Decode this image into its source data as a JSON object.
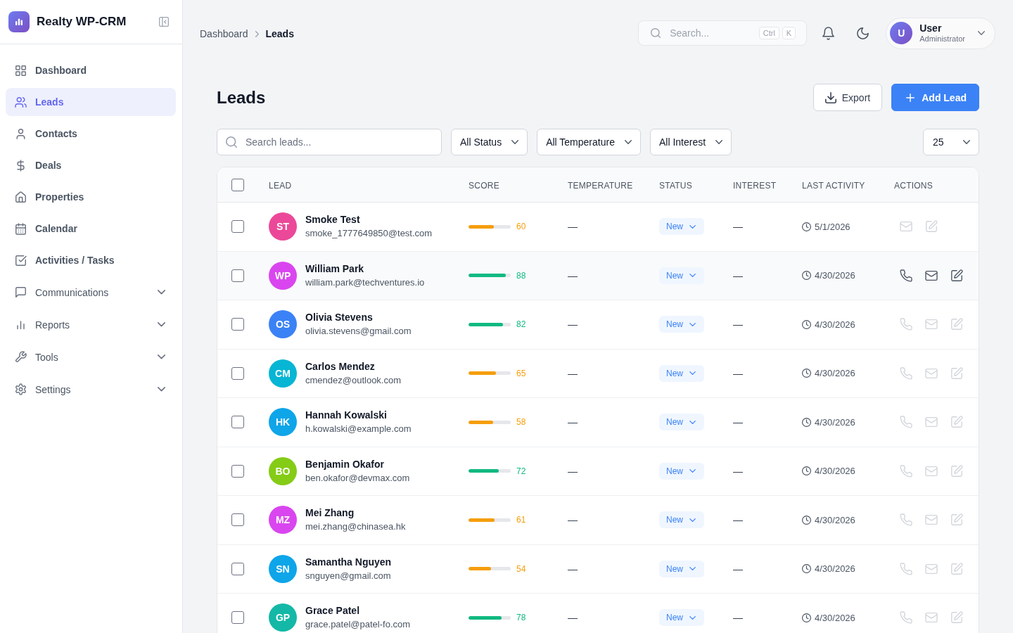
{
  "sidebar": {
    "brand": "Realty WP-CRM",
    "items": [
      {
        "label": "Dashboard",
        "kind": "link",
        "selected": false
      },
      {
        "label": "Leads",
        "kind": "link",
        "selected": true
      },
      {
        "label": "Contacts",
        "kind": "link",
        "selected": false
      },
      {
        "label": "Deals",
        "kind": "link",
        "selected": false
      },
      {
        "label": "Properties",
        "kind": "link",
        "selected": false
      },
      {
        "label": "Calendar",
        "kind": "link",
        "selected": false
      },
      {
        "label": "Activities / Tasks",
        "kind": "link",
        "selected": false
      },
      {
        "label": "Communications",
        "kind": "group",
        "selected": false,
        "expanded": false
      },
      {
        "label": "Reports",
        "kind": "group",
        "selected": false,
        "expanded": false
      },
      {
        "label": "Tools",
        "kind": "group",
        "selected": false,
        "expanded": false
      },
      {
        "label": "Settings",
        "kind": "group",
        "selected": false,
        "expanded": false
      }
    ]
  },
  "breadcrumb": [
    "Dashboard",
    "Leads"
  ],
  "top_search": {
    "placeholder": "Search...",
    "shortcut": [
      "Ctrl",
      "K"
    ]
  },
  "user": {
    "initial": "U",
    "name": "User",
    "role": "Administrator"
  },
  "page": {
    "title": "Leads",
    "buttons": [
      {
        "label": "Export",
        "kind": "secondary"
      },
      {
        "label": "Add Lead",
        "kind": "primary"
      }
    ]
  },
  "filters": {
    "search": {
      "placeholder": "Search leads..."
    },
    "selects": [
      "All Status",
      "All Temperature",
      "All Interest"
    ],
    "page_size": "25"
  },
  "table": {
    "columns": [
      "LEAD",
      "SCORE",
      "TEMPERATURE",
      "STATUS",
      "INTEREST",
      "LAST ACTIVITY",
      "ACTIONS"
    ],
    "all_checked": false,
    "rows": [
      {
        "initials": "ST",
        "color": "#ec4899",
        "name": "Smoke Test",
        "email": "smoke_1777649850@test.com",
        "score": {
          "value": "60",
          "level": 0.6,
          "color": "#f59e0b"
        },
        "temperature": "—",
        "status": "New",
        "interest": "—",
        "last_activity": "5/1/2026",
        "checked": false,
        "hovered": false,
        "call_action": false
      },
      {
        "initials": "WP",
        "color": "#d946ef",
        "name": "William Park",
        "email": "william.park@techventures.io",
        "score": {
          "value": "88",
          "level": 0.88,
          "color": "#10b981"
        },
        "temperature": "—",
        "status": "New",
        "interest": "—",
        "last_activity": "4/30/2026",
        "checked": false,
        "hovered": true,
        "call_action": true
      },
      {
        "initials": "OS",
        "color": "#3b82f6",
        "name": "Olivia Stevens",
        "email": "olivia.stevens@gmail.com",
        "score": {
          "value": "82",
          "level": 0.82,
          "color": "#10b981"
        },
        "temperature": "—",
        "status": "New",
        "interest": "—",
        "last_activity": "4/30/2026",
        "checked": false,
        "hovered": false,
        "call_action": true
      },
      {
        "initials": "CM",
        "color": "#06b6d4",
        "name": "Carlos Mendez",
        "email": "cmendez@outlook.com",
        "score": {
          "value": "65",
          "level": 0.65,
          "color": "#f59e0b"
        },
        "temperature": "—",
        "status": "New",
        "interest": "—",
        "last_activity": "4/30/2026",
        "checked": false,
        "hovered": false,
        "call_action": true
      },
      {
        "initials": "HK",
        "color": "#0ea5e9",
        "name": "Hannah Kowalski",
        "email": "h.kowalski@example.com",
        "score": {
          "value": "58",
          "level": 0.58,
          "color": "#f59e0b"
        },
        "temperature": "—",
        "status": "New",
        "interest": "—",
        "last_activity": "4/30/2026",
        "checked": false,
        "hovered": false,
        "call_action": true
      },
      {
        "initials": "BO",
        "color": "#84cc16",
        "name": "Benjamin Okafor",
        "email": "ben.okafor@devmax.com",
        "score": {
          "value": "72",
          "level": 0.72,
          "color": "#10b981"
        },
        "temperature": "—",
        "status": "New",
        "interest": "—",
        "last_activity": "4/30/2026",
        "checked": false,
        "hovered": false,
        "call_action": true
      },
      {
        "initials": "MZ",
        "color": "#d946ef",
        "name": "Mei Zhang",
        "email": "mei.zhang@chinasea.hk",
        "score": {
          "value": "61",
          "level": 0.61,
          "color": "#f59e0b"
        },
        "temperature": "—",
        "status": "New",
        "interest": "—",
        "last_activity": "4/30/2026",
        "checked": false,
        "hovered": false,
        "call_action": true
      },
      {
        "initials": "SN",
        "color": "#0ea5e9",
        "name": "Samantha Nguyen",
        "email": "snguyen@gmail.com",
        "score": {
          "value": "54",
          "level": 0.54,
          "color": "#f59e0b"
        },
        "temperature": "—",
        "status": "New",
        "interest": "—",
        "last_activity": "4/30/2026",
        "checked": false,
        "hovered": false,
        "call_action": true
      },
      {
        "initials": "GP",
        "color": "#14b8a6",
        "name": "Grace Patel",
        "email": "grace.patel@patel-fo.com",
        "score": {
          "value": "78",
          "level": 0.78,
          "color": "#10b981"
        },
        "temperature": "—",
        "status": "New",
        "interest": "—",
        "last_activity": "4/30/2026",
        "checked": false,
        "hovered": false,
        "call_action": true
      }
    ]
  }
}
